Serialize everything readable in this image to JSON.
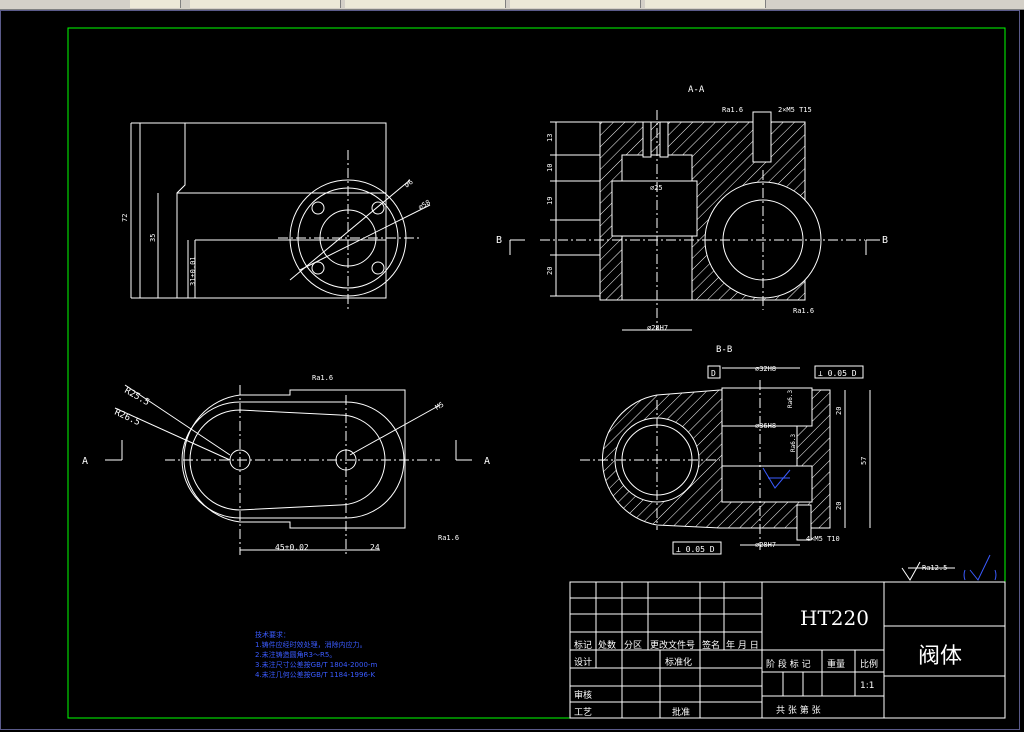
{
  "window": {
    "tabs": [
      "",
      "",
      "",
      "",
      ""
    ]
  },
  "views": {
    "section_aa": "A-A",
    "section_bb": "B-B",
    "marker_a": "A",
    "marker_b": "B"
  },
  "roughness": {
    "ra_1_6": "Ra1.6",
    "ra_12_5": "Ra12.5",
    "ra_3_2": "Ra3.2",
    "ra_6_3": "Ra6.3"
  },
  "dimensions": {
    "d72": "72",
    "d35": "35",
    "d31": "31±0.01",
    "d6": "∅6",
    "d58": "∅58",
    "d13": "13",
    "d10": "10",
    "d19": "19",
    "d20": "20",
    "d25": "∅25",
    "d28h7": "∅28H7",
    "d32h8": "∅32H8",
    "d36h8": "∅36H8",
    "d28h7b": "∅28H7",
    "d57": "57",
    "d20a": "20",
    "d20b": "20",
    "m5": "2×M5 T15",
    "m5b": "4×M5 T10",
    "r25": "R25.5",
    "r26": "R26.5",
    "m5c": "M5",
    "d45": "45±0.02",
    "d24": "24"
  },
  "tolerances": {
    "perp1": "⊥ 0.05 D",
    "perp2": "⊥ 0.05 D",
    "datum": "D"
  },
  "notes": {
    "heading": "技术要求：",
    "items": [
      "1.铸件应经时效处理，消除内应力。",
      "2.未注铸造圆角R3～R5。",
      "3.未注尺寸公差按GB/T 1804-2000-m",
      "4.未注几何公差按GB/T 1184-1996-K"
    ]
  },
  "title_block": {
    "material": "HT220",
    "part_name": "阀体",
    "scale_label": "比例",
    "scale_value": "1:1",
    "weight_label": "重量",
    "stage_label": "阶 段 标 记",
    "headers": [
      "标记",
      "处数",
      "分区",
      "更改文件号",
      "签名",
      "年 月 日"
    ],
    "design": "设计",
    "standard": "标准化",
    "review": "审核",
    "process": "工艺",
    "approve": "批准",
    "sheets": "共   张   第   张"
  },
  "colors": {
    "border": "#00ff00",
    "line": "#ffffff",
    "center": "#ffffff",
    "notes": "#3a5bff",
    "symbol": "#3a5bff"
  }
}
